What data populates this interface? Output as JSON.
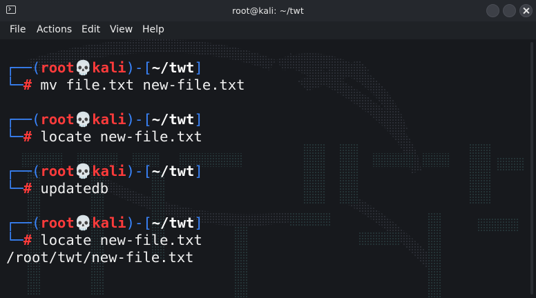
{
  "window": {
    "title": "root@kali: ~/twt"
  },
  "menu": {
    "items": [
      "File",
      "Actions",
      "Edit",
      "View",
      "Help"
    ]
  },
  "prompt": {
    "top_open": "┌──(",
    "user": "root",
    "skull": "💀",
    "host": "kali",
    "mid": ")-[",
    "path": "~/twt",
    "top_close": "]",
    "bottom_prefix": "└─",
    "symbol": "#"
  },
  "commands": [
    {
      "command": " mv file.txt new-file.txt",
      "output": ""
    },
    {
      "command": " locate new-file.txt",
      "output": ""
    },
    {
      "command": " updatedb",
      "output": ""
    },
    {
      "command": " locate new-file.txt",
      "output": "/root/twt/new-file.txt"
    }
  ],
  "colors": {
    "prompt_blue": "#3a86ff",
    "prompt_red": "#ff3b3b",
    "background": "#17191d"
  }
}
